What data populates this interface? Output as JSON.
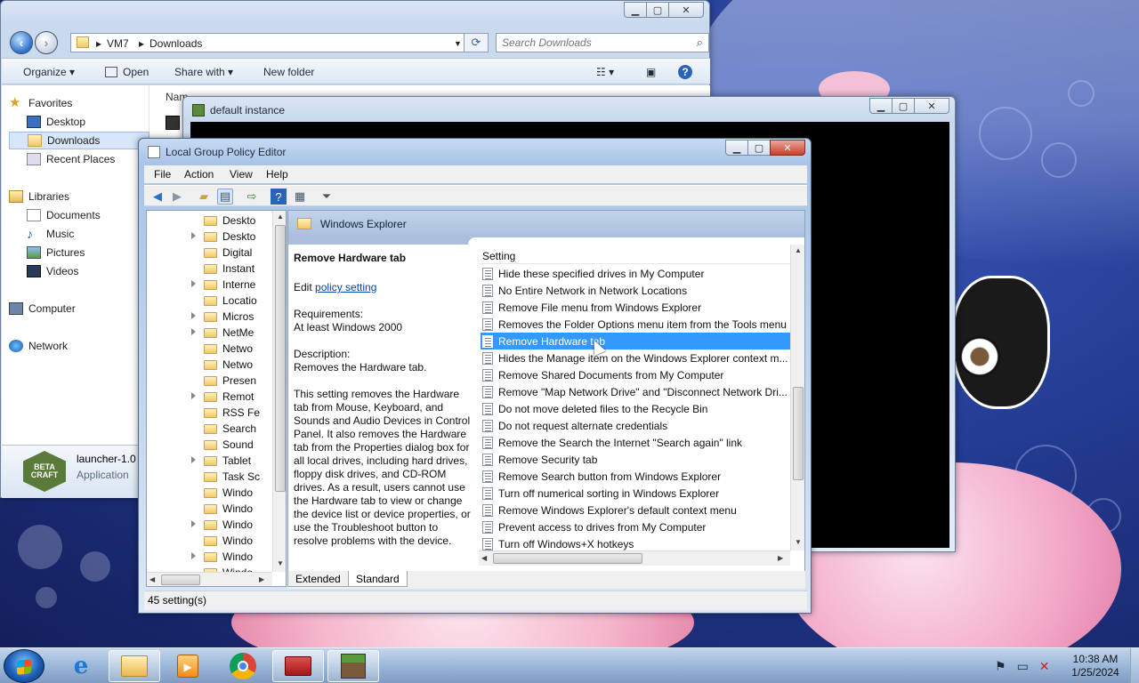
{
  "explorer": {
    "address": [
      "VM7",
      "Downloads"
    ],
    "search_placeholder": "Search Downloads",
    "commands": {
      "organize": "Organize",
      "open": "Open",
      "share_with": "Share with",
      "new_folder": "New folder"
    },
    "name_header": "Nam",
    "nav": {
      "favorites": "Favorites",
      "desktop": "Desktop",
      "downloads": "Downloads",
      "recent_places": "Recent Places",
      "libraries": "Libraries",
      "documents": "Documents",
      "music": "Music",
      "pictures": "Pictures",
      "videos": "Videos",
      "computer": "Computer",
      "network": "Network"
    },
    "details": {
      "name": "launcher-1.0",
      "type": "Application",
      "logo_text": "BETA CRAFT"
    }
  },
  "minecraft": {
    "title": "default instance"
  },
  "gpe": {
    "title": "Local Group Policy Editor",
    "menu": {
      "file": "File",
      "action": "Action",
      "view": "View",
      "help": "Help"
    },
    "tree": [
      "Deskto",
      "Deskto",
      "Digital",
      "Instant",
      "Interne",
      "Locatio",
      "Micros",
      "NetMe",
      "Netwo",
      "Netwo",
      "Presen",
      "Remot",
      "RSS Fe",
      "Search",
      "Sound",
      "Tablet",
      "Task Sc",
      "Windo",
      "Windo",
      "Windo",
      "Windo",
      "Windo",
      "Windo"
    ],
    "folder_title": "Windows Explorer",
    "description": {
      "heading": "Remove Hardware tab",
      "edit_prefix": "Edit",
      "edit_link": "policy setting",
      "requirements_label": "Requirements:",
      "requirements": "At least Windows 2000",
      "description_label": "Description:",
      "description": "Removes the Hardware tab.",
      "body": "This setting removes the Hardware tab from Mouse, Keyboard, and Sounds and Audio Devices in Control Panel. It also removes the Hardware tab from the Properties dialog box for all local drives, including hard drives, floppy disk drives, and CD-ROM drives. As a result, users cannot use the Hardware tab to view or change the device list or device properties, or use the Troubleshoot button to resolve problems with the device."
    },
    "settings_header": "Setting",
    "settings": [
      "Hide these specified drives in My Computer",
      "No Entire Network in Network Locations",
      "Remove File menu from Windows Explorer",
      "Removes the Folder Options menu item from the Tools menu",
      "Remove Hardware tab",
      "Hides the Manage item on the Windows Explorer context m...",
      "Remove Shared Documents from My Computer",
      "Remove \"Map Network Drive\" and \"Disconnect Network Dri...",
      "Do not move deleted files to the Recycle Bin",
      "Do not request alternate credentials",
      "Remove the Search the Internet \"Search again\" link",
      "Remove Security tab",
      "Remove Search button from Windows Explorer",
      "Turn off numerical sorting in Windows Explorer",
      "Remove Windows Explorer's default context menu",
      "Prevent access to drives from My Computer",
      "Turn off Windows+X hotkeys"
    ],
    "selected_index": 4,
    "tabs": {
      "extended": "Extended",
      "standard": "Standard"
    },
    "status": "45 setting(s)"
  },
  "taskbar": {
    "time": "10:38 AM",
    "date": "1/25/2024"
  }
}
